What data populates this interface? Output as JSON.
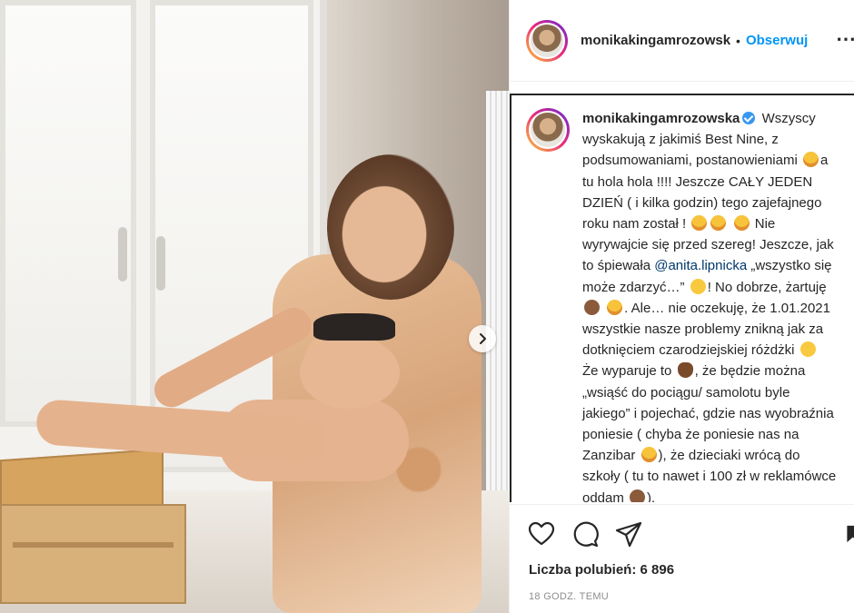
{
  "post": {
    "username": "monikakingamrozowska",
    "header_username": "monikakingamrozowsk",
    "separator": "•",
    "follow_label": "Obserwuj",
    "more_label": "⋯",
    "caption_parts": [
      "Wszyscy wyskakują z jakimiś Best Nine, z podsumowaniami, postanowieniami",
      "a tu hola hola !!!! Jeszcze CAŁY JEDEN DZIEŃ ( i kilka godzin) tego zajefajnego roku nam został !",
      "Nie wyrywajcie się przed szereg! Jeszcze, jak to śpiewała",
      "@anita.lipnicka",
      "„wszystko się może zdarzyć…”",
      "! No dobrze, żartuję",
      ". Ale… nie oczekuję, że 1.01.2021 wszystkie nasze problemy znikną jak za dotknięciem czarodziejskiej różdżki",
      "Że wyparuje to",
      ", że będzie można „wsiąść do pociągu/ samolotu byle jakiego” i pojechać, gdzie nas wyobraźnia poniesie ( chyba że poniesie nas na Zanzibar",
      "), że dzieciaki wrócą do szkoły ( tu to nawet i 100 zł w reklamówce oddam",
      ")."
    ],
    "likes_label": "Liczba polubień: 6 896",
    "time_label": "18 GODZ. TEMU"
  },
  "colors": {
    "accent": "#0095f6",
    "mention": "#00376b",
    "verified": "#3897f0",
    "muted": "#8e8e8e"
  },
  "icons": [
    "heart-icon",
    "comment-icon",
    "share-icon",
    "bookmark-icon",
    "chevron-right-icon",
    "verified-icon"
  ]
}
